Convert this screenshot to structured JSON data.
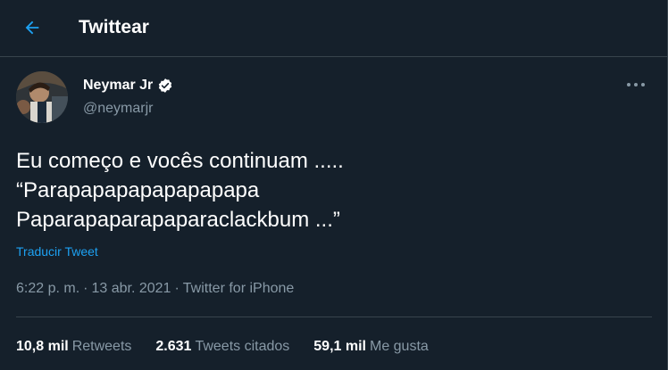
{
  "header": {
    "title": "Twittear",
    "back_icon": "arrow-left-icon",
    "accent_color": "#1da1f2"
  },
  "author": {
    "display_name": "Neymar Jr",
    "handle": "@neymarjr",
    "verified": true,
    "verified_icon": "verified-badge-icon"
  },
  "tweet": {
    "lines": [
      "Eu começo e vocês continuam .....",
      "“Parapapapapapapapapa",
      "Paparapaparapaparaclackbum ...”"
    ],
    "translate_label": "Traducir Tweet",
    "time": "6:22 p. m.",
    "date": "13 abr. 2021",
    "source": "Twitter for iPhone",
    "separator": "·"
  },
  "stats": [
    {
      "count": "10,8 mil",
      "label": "Retweets"
    },
    {
      "count": "2.631",
      "label": "Tweets citados"
    },
    {
      "count": "59,1 mil",
      "label": "Me gusta"
    }
  ],
  "colors": {
    "background": "#15202b",
    "border": "#38444d",
    "secondary_text": "#8899a6",
    "link": "#1da1f2"
  }
}
